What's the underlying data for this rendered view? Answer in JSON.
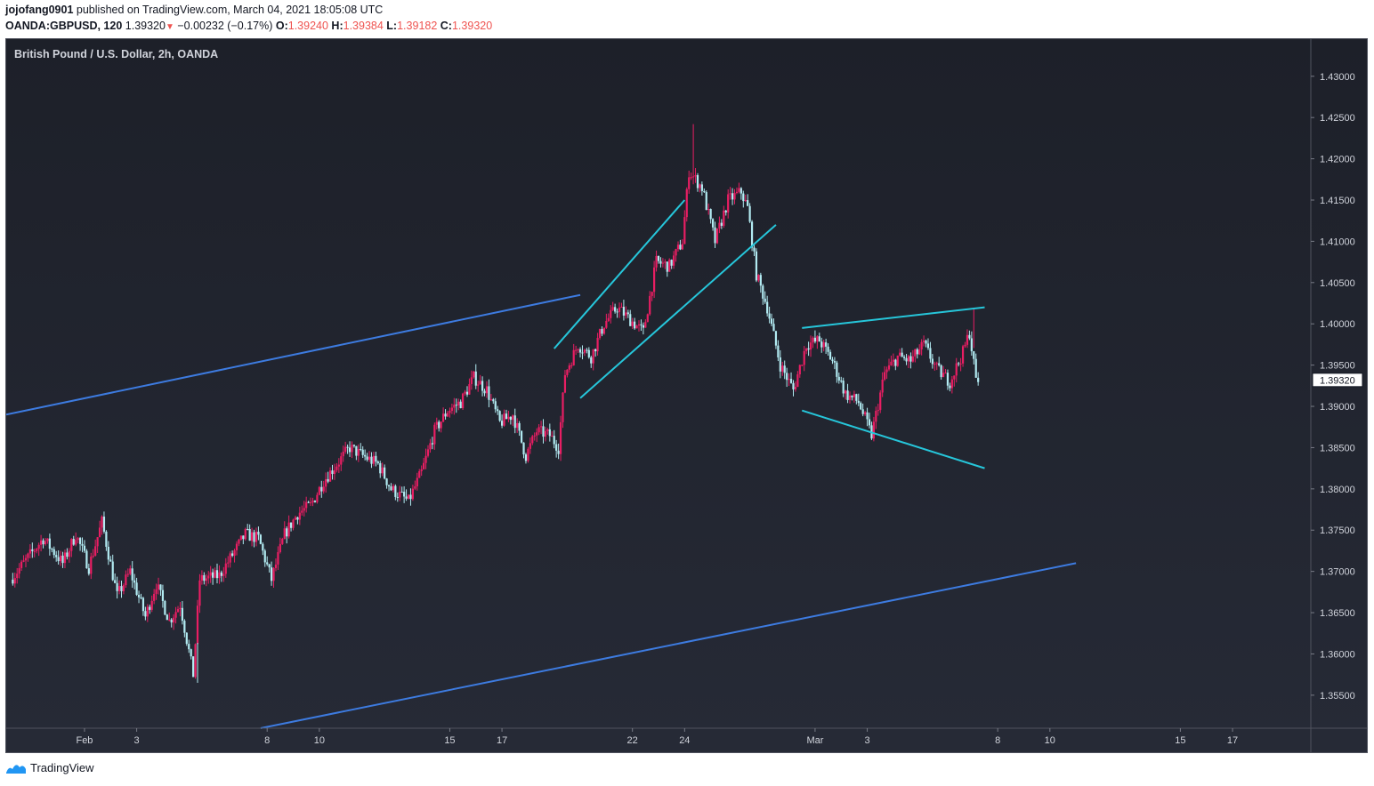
{
  "header": {
    "author": "jojofang0901",
    "published": "published on TradingView.com, March 04, 2021 18:05:08 UTC",
    "symbol": "OANDA:GBPUSD, 120",
    "last": "1.39320",
    "change": "−0.00232 (−0.17%)",
    "o_label": "O:",
    "o_value": "1.39240",
    "h_label": "H:",
    "h_value": "1.39384",
    "l_label": "L:",
    "l_value": "1.39182",
    "c_label": "C:",
    "c_value": "1.39320"
  },
  "footer": {
    "brand": "TradingView"
  },
  "colors": {
    "up": "#e91e63",
    "down": "#b2ebf2",
    "trend": "#3d7be0",
    "pattern": "#26c6da",
    "header_red": "#ef5350"
  },
  "chart_data": {
    "type": "candlestick",
    "title": "British Pound / U.S. Dollar, 2h, OANDA",
    "current_price": "1.39320",
    "y_range": [
      1.351,
      1.4345
    ],
    "y_ticks": [
      "1.43000",
      "1.42500",
      "1.42000",
      "1.41500",
      "1.41000",
      "1.40500",
      "1.40000",
      "1.39500",
      "1.39000",
      "1.38500",
      "1.38000",
      "1.37500",
      "1.37000",
      "1.36500",
      "1.36000",
      "1.35500"
    ],
    "x_axis": {
      "start": "2021-01-29",
      "end": "2021-03-20",
      "ticks": [
        {
          "date": "2021-02-01",
          "label": "Feb"
        },
        {
          "date": "2021-02-03",
          "label": "3"
        },
        {
          "date": "2021-02-08",
          "label": "8"
        },
        {
          "date": "2021-02-10",
          "label": "10"
        },
        {
          "date": "2021-02-15",
          "label": "15"
        },
        {
          "date": "2021-02-17",
          "label": "17"
        },
        {
          "date": "2021-02-22",
          "label": "22"
        },
        {
          "date": "2021-02-24",
          "label": "24"
        },
        {
          "date": "2021-03-01",
          "label": "Mar"
        },
        {
          "date": "2021-03-03",
          "label": "3"
        },
        {
          "date": "2021-03-08",
          "label": "8"
        },
        {
          "date": "2021-03-10",
          "label": "10"
        },
        {
          "date": "2021-03-15",
          "label": "15"
        },
        {
          "date": "2021-03-17",
          "label": "17"
        }
      ]
    },
    "price_path": [
      [
        "2021-01-29T06:00",
        1.369
      ],
      [
        "2021-01-30T12:00",
        1.374
      ],
      [
        "2021-01-31T06:00",
        1.371
      ],
      [
        "2021-01-31T18:00",
        1.3745
      ],
      [
        "2021-02-01T06:00",
        1.3705
      ],
      [
        "2021-02-01T18:00",
        1.376
      ],
      [
        "2021-02-02T08:00",
        1.367
      ],
      [
        "2021-02-02T20:00",
        1.37
      ],
      [
        "2021-02-03T10:00",
        1.3645
      ],
      [
        "2021-02-03T20:00",
        1.3685
      ],
      [
        "2021-02-04T08:00",
        1.364
      ],
      [
        "2021-02-04T18:00",
        1.366
      ],
      [
        "2021-02-05T06:00",
        1.3575
      ],
      [
        "2021-02-05T12:00",
        1.369
      ],
      [
        "2021-02-06T06:00",
        1.3695
      ],
      [
        "2021-02-06T18:00",
        1.372
      ],
      [
        "2021-02-07T06:00",
        1.3745
      ],
      [
        "2021-02-07T18:00",
        1.374
      ],
      [
        "2021-02-08T06:00",
        1.369
      ],
      [
        "2021-02-08T18:00",
        1.3745
      ],
      [
        "2021-02-09T06:00",
        1.377
      ],
      [
        "2021-02-09T18:00",
        1.378
      ],
      [
        "2021-02-10T06:00",
        1.381
      ],
      [
        "2021-02-10T18:00",
        1.383
      ],
      [
        "2021-02-11T06:00",
        1.385
      ],
      [
        "2021-02-11T18:00",
        1.384
      ],
      [
        "2021-02-12T08:00",
        1.383
      ],
      [
        "2021-02-12T20:00",
        1.38
      ],
      [
        "2021-02-13T12:00",
        1.3785
      ],
      [
        "2021-02-14T00:00",
        1.382
      ],
      [
        "2021-02-14T12:00",
        1.387
      ],
      [
        "2021-02-15T00:00",
        1.3895
      ],
      [
        "2021-02-15T12:00",
        1.3905
      ],
      [
        "2021-02-16T00:00",
        1.3935
      ],
      [
        "2021-02-16T12:00",
        1.392
      ],
      [
        "2021-02-17T00:00",
        1.388
      ],
      [
        "2021-02-17T12:00",
        1.389
      ],
      [
        "2021-02-18T00:00",
        1.384
      ],
      [
        "2021-02-18T10:00",
        1.387
      ],
      [
        "2021-02-18T22:00",
        1.3865
      ],
      [
        "2021-02-19T06:00",
        1.385
      ],
      [
        "2021-02-19T12:00",
        1.394
      ],
      [
        "2021-02-20T00:00",
        1.3975
      ],
      [
        "2021-02-20T12:00",
        1.396
      ],
      [
        "2021-02-21T00:00",
        1.4
      ],
      [
        "2021-02-21T12:00",
        1.402
      ],
      [
        "2021-02-22T00:00",
        1.4005
      ],
      [
        "2021-02-22T12:00",
        1.399
      ],
      [
        "2021-02-23T00:00",
        1.4075
      ],
      [
        "2021-02-23T12:00",
        1.407
      ],
      [
        "2021-02-24T00:00",
        1.41
      ],
      [
        "2021-02-24T06:00",
        1.4185
      ],
      [
        "2021-02-24T18:00",
        1.4165
      ],
      [
        "2021-02-25T06:00",
        1.41
      ],
      [
        "2021-02-25T18:00",
        1.415
      ],
      [
        "2021-02-26T06:00",
        1.416
      ],
      [
        "2021-02-26T12:00",
        1.414
      ],
      [
        "2021-02-26T20:00",
        1.406
      ],
      [
        "2021-02-27T06:00",
        1.402
      ],
      [
        "2021-02-27T18:00",
        1.395
      ],
      [
        "2021-02-28T06:00",
        1.392
      ],
      [
        "2021-02-28T18:00",
        1.3975
      ],
      [
        "2021-03-01T06:00",
        1.398
      ],
      [
        "2021-03-01T18:00",
        1.3955
      ],
      [
        "2021-03-02T06:00",
        1.3915
      ],
      [
        "2021-03-02T18:00",
        1.3905
      ],
      [
        "2021-03-03T06:00",
        1.3865
      ],
      [
        "2021-03-03T18:00",
        1.394
      ],
      [
        "2021-03-04T06:00",
        1.396
      ],
      [
        "2021-03-04T18:00",
        1.3955
      ],
      [
        "2021-03-05T06:00",
        1.3975
      ],
      [
        "2021-03-05T18:00",
        1.3945
      ],
      [
        "2021-03-06T06:00",
        1.393
      ],
      [
        "2021-03-06T18:00",
        1.3965
      ],
      [
        "2021-03-07T00:00",
        1.399
      ],
      [
        "2021-03-07T06:00",
        1.3932
      ]
    ],
    "spikes": [
      {
        "date": "2021-02-24T08:00",
        "high": 1.4242
      },
      {
        "date": "2021-02-05T08:00",
        "low": 1.3565
      },
      {
        "date": "2021-03-07T02:00",
        "high": 1.4018
      }
    ],
    "trend_lines": [
      {
        "role": "upper-channel",
        "from": [
          "2021-01-29T00:00",
          1.389
        ],
        "to": [
          "2021-02-20T00:00",
          1.4035
        ]
      },
      {
        "role": "lower-channel",
        "from": [
          "2021-02-07T18:00",
          1.351
        ],
        "to": [
          "2021-03-11T00:00",
          1.371
        ]
      },
      {
        "role": "flag-top",
        "from": [
          "2021-02-19T00:00",
          1.397
        ],
        "to": [
          "2021-02-24T00:00",
          1.415
        ]
      },
      {
        "role": "flag-bottom",
        "from": [
          "2021-02-20T00:00",
          1.391
        ],
        "to": [
          "2021-02-27T12:00",
          1.412
        ]
      },
      {
        "role": "wedge-top",
        "from": [
          "2021-02-28T12:00",
          1.3995
        ],
        "to": [
          "2021-03-07T12:00",
          1.402
        ]
      },
      {
        "role": "wedge-bottom",
        "from": [
          "2021-02-28T12:00",
          1.3895
        ],
        "to": [
          "2021-03-07T12:00",
          1.3825
        ]
      }
    ]
  }
}
